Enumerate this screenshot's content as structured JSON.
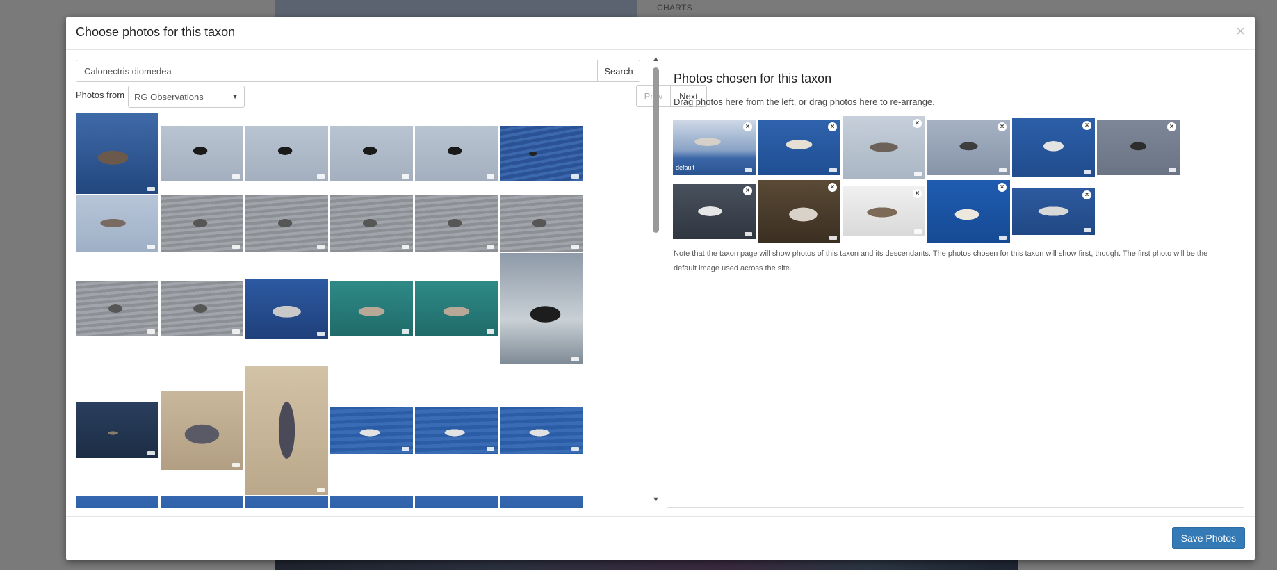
{
  "background": {
    "charts_label": "CHARTS"
  },
  "modal": {
    "title": "Choose photos for this taxon",
    "close_glyph": "×",
    "save_label": "Save Photos"
  },
  "search": {
    "query": "Calonectris diomedea",
    "button_label": "Search",
    "source_label": "Photos from",
    "source_selected": "RG Observations",
    "prev_label": "Prev",
    "next_label": "Next"
  },
  "chosen": {
    "title": "Photos chosen for this taxon",
    "hint": "Drag photos here from the left, or drag photos here to re-arrange.",
    "default_label": "default",
    "note": "Note that the taxon page will show photos of this taxon and its descendants. The photos chosen for this taxon will show first, though. The first photo will be the default image used across the site."
  },
  "icons": {
    "close": "close-icon",
    "remove": "remove-photo-icon",
    "dropdown": "chevron-down-icon",
    "scroll_up": "scroll-up-arrow-icon",
    "scroll_down": "scroll-down-arrow-icon"
  },
  "colors": {
    "primary": "#337ab7",
    "sea_blue": "#2f5e9c",
    "sky_grey": "#aeb9c6"
  },
  "results_rows": [
    [
      "sea-bird-pair",
      "sky-shearwater",
      "sky-shearwater",
      "sky-shearwater",
      "sky-shearwater",
      "sea-small-bird"
    ],
    [
      "sky-shearwater-pale",
      "grey-water-bird",
      "grey-water-bird",
      "grey-water-bird",
      "grey-water-bird",
      "grey-water-bird"
    ],
    [
      "grey-water-bird",
      "grey-water-bird",
      "sea-bird-close",
      "green-water-bird",
      "green-water-bird",
      "bird-on-chair"
    ],
    [
      "dark-sea-bird",
      "bird-on-sand",
      "bird-on-sand-tall",
      "sea-bird-floating",
      "sea-bird-floating",
      "sea-bird-floating"
    ],
    [
      "sea-partial",
      "sea-partial",
      "sea-partial",
      "sea-partial",
      "sea-partial",
      "sea-partial"
    ]
  ],
  "chosen_photos": [
    [
      "sky-bird-default",
      "sea-bird-flight",
      "sky-bird-glide",
      "grey-bird-flight",
      "sea-bird-banking",
      "sky-bird-profile"
    ],
    [
      "water-group",
      "bird-nesting",
      "bird-on-white",
      "sea-bird-swimming",
      "water-group-small"
    ]
  ]
}
